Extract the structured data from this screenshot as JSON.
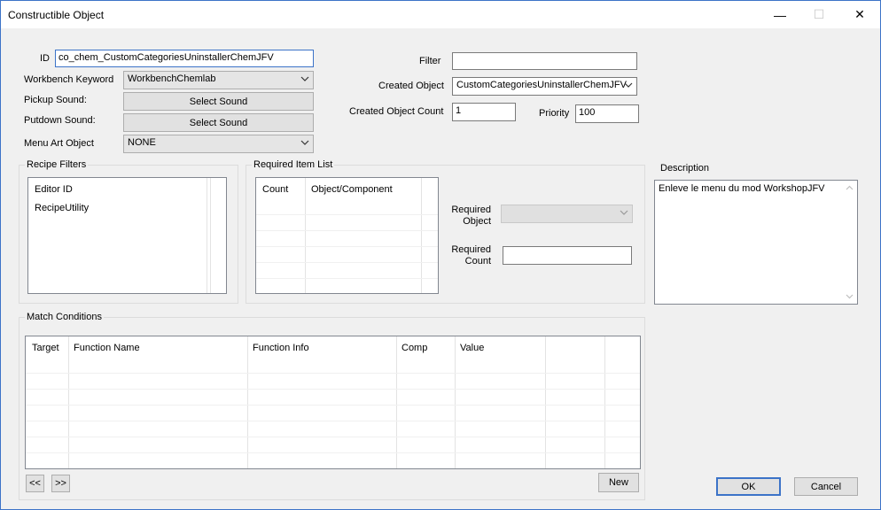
{
  "window": {
    "title": "Constructible Object",
    "minimize_glyph": "—",
    "maximize_glyph": "☐",
    "close_glyph": "✕"
  },
  "form": {
    "id_label": "ID",
    "id_value": "co_chem_CustomCategoriesUninstallerChemJFV",
    "workbench_label": "Workbench Keyword",
    "workbench_value": "WorkbenchChemlab",
    "pickup_label": "Pickup Sound:",
    "pickup_button": "Select Sound",
    "putdown_label": "Putdown Sound:",
    "putdown_button": "Select Sound",
    "menu_art_label": "Menu Art Object",
    "menu_art_value": "NONE",
    "filter_label": "Filter",
    "filter_value": "",
    "created_object_label": "Created Object",
    "created_object_value": "CustomCategoriesUninstallerChemJFV",
    "created_count_label": "Created Object Count",
    "created_count_value": "1",
    "priority_label": "Priority",
    "priority_value": "100"
  },
  "recipe_filters": {
    "title": "Recipe Filters",
    "header": "Editor ID",
    "items": [
      "RecipeUtility"
    ]
  },
  "required_items": {
    "title": "Required Item List",
    "columns": [
      "Count",
      "Object/Component"
    ],
    "required_object_label": "Required\nObject",
    "required_object_label_1": "Required",
    "required_object_label_2": "Object",
    "required_count_label_1": "Required",
    "required_count_label_2": "Count",
    "required_object_value": "",
    "required_count_value": ""
  },
  "description": {
    "title": "Description",
    "text": "Enleve le menu du mod WorkshopJFV"
  },
  "match_conditions": {
    "title": "Match Conditions",
    "columns": [
      "Target",
      "Function Name",
      "Function Info",
      "Comp",
      "Value"
    ],
    "prev_button": "<<",
    "next_button": ">>",
    "new_button": "New"
  },
  "footer": {
    "ok_button": "OK",
    "cancel_button": "Cancel"
  },
  "colors": {
    "accent": "#3c73c8",
    "dialog_bg": "#f0f0f0"
  },
  "icons": [
    "chevron-down-icon",
    "close-icon",
    "minimize-icon",
    "maximize-icon",
    "scroll-up-icon",
    "scroll-down-icon"
  ]
}
